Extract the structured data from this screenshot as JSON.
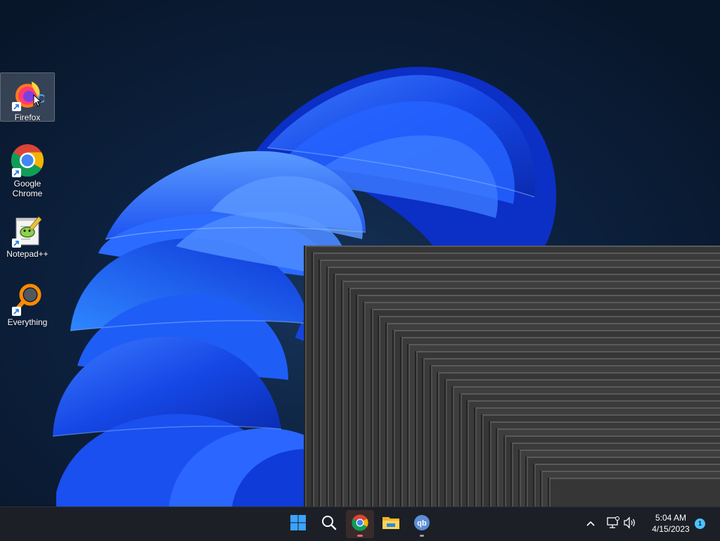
{
  "desktop": {
    "icons": [
      {
        "label": "Firefox",
        "icon": "firefox-icon",
        "selected": true
      },
      {
        "label": "Google Chrome",
        "icon": "chrome-icon"
      },
      {
        "label": "Notepad++",
        "icon": "notepad-plus-plus-icon"
      },
      {
        "label": "Everything",
        "icon": "everything-search-icon"
      }
    ],
    "wallpaper": "windows-11-bloom-blue"
  },
  "taskbar": {
    "apps": [
      {
        "name": "Start",
        "icon": "windows-start-icon"
      },
      {
        "name": "Search",
        "icon": "search-icon"
      },
      {
        "name": "Google Chrome",
        "icon": "chrome-icon",
        "running": true,
        "active": true
      },
      {
        "name": "File Explorer",
        "icon": "file-explorer-icon"
      },
      {
        "name": "qBittorrent",
        "icon": "qbittorrent-icon",
        "running": true
      }
    ],
    "tray": {
      "overflow_icon": "chevron-up-icon",
      "network_icon": "network-icon",
      "volume_icon": "volume-icon",
      "time": "5:04 AM",
      "date": "4/15/2023",
      "notification_count": "1"
    }
  },
  "colors": {
    "accent": "#4cc2ff",
    "taskbar": "#1c1f26",
    "window_gray": "#3a3a3a"
  }
}
